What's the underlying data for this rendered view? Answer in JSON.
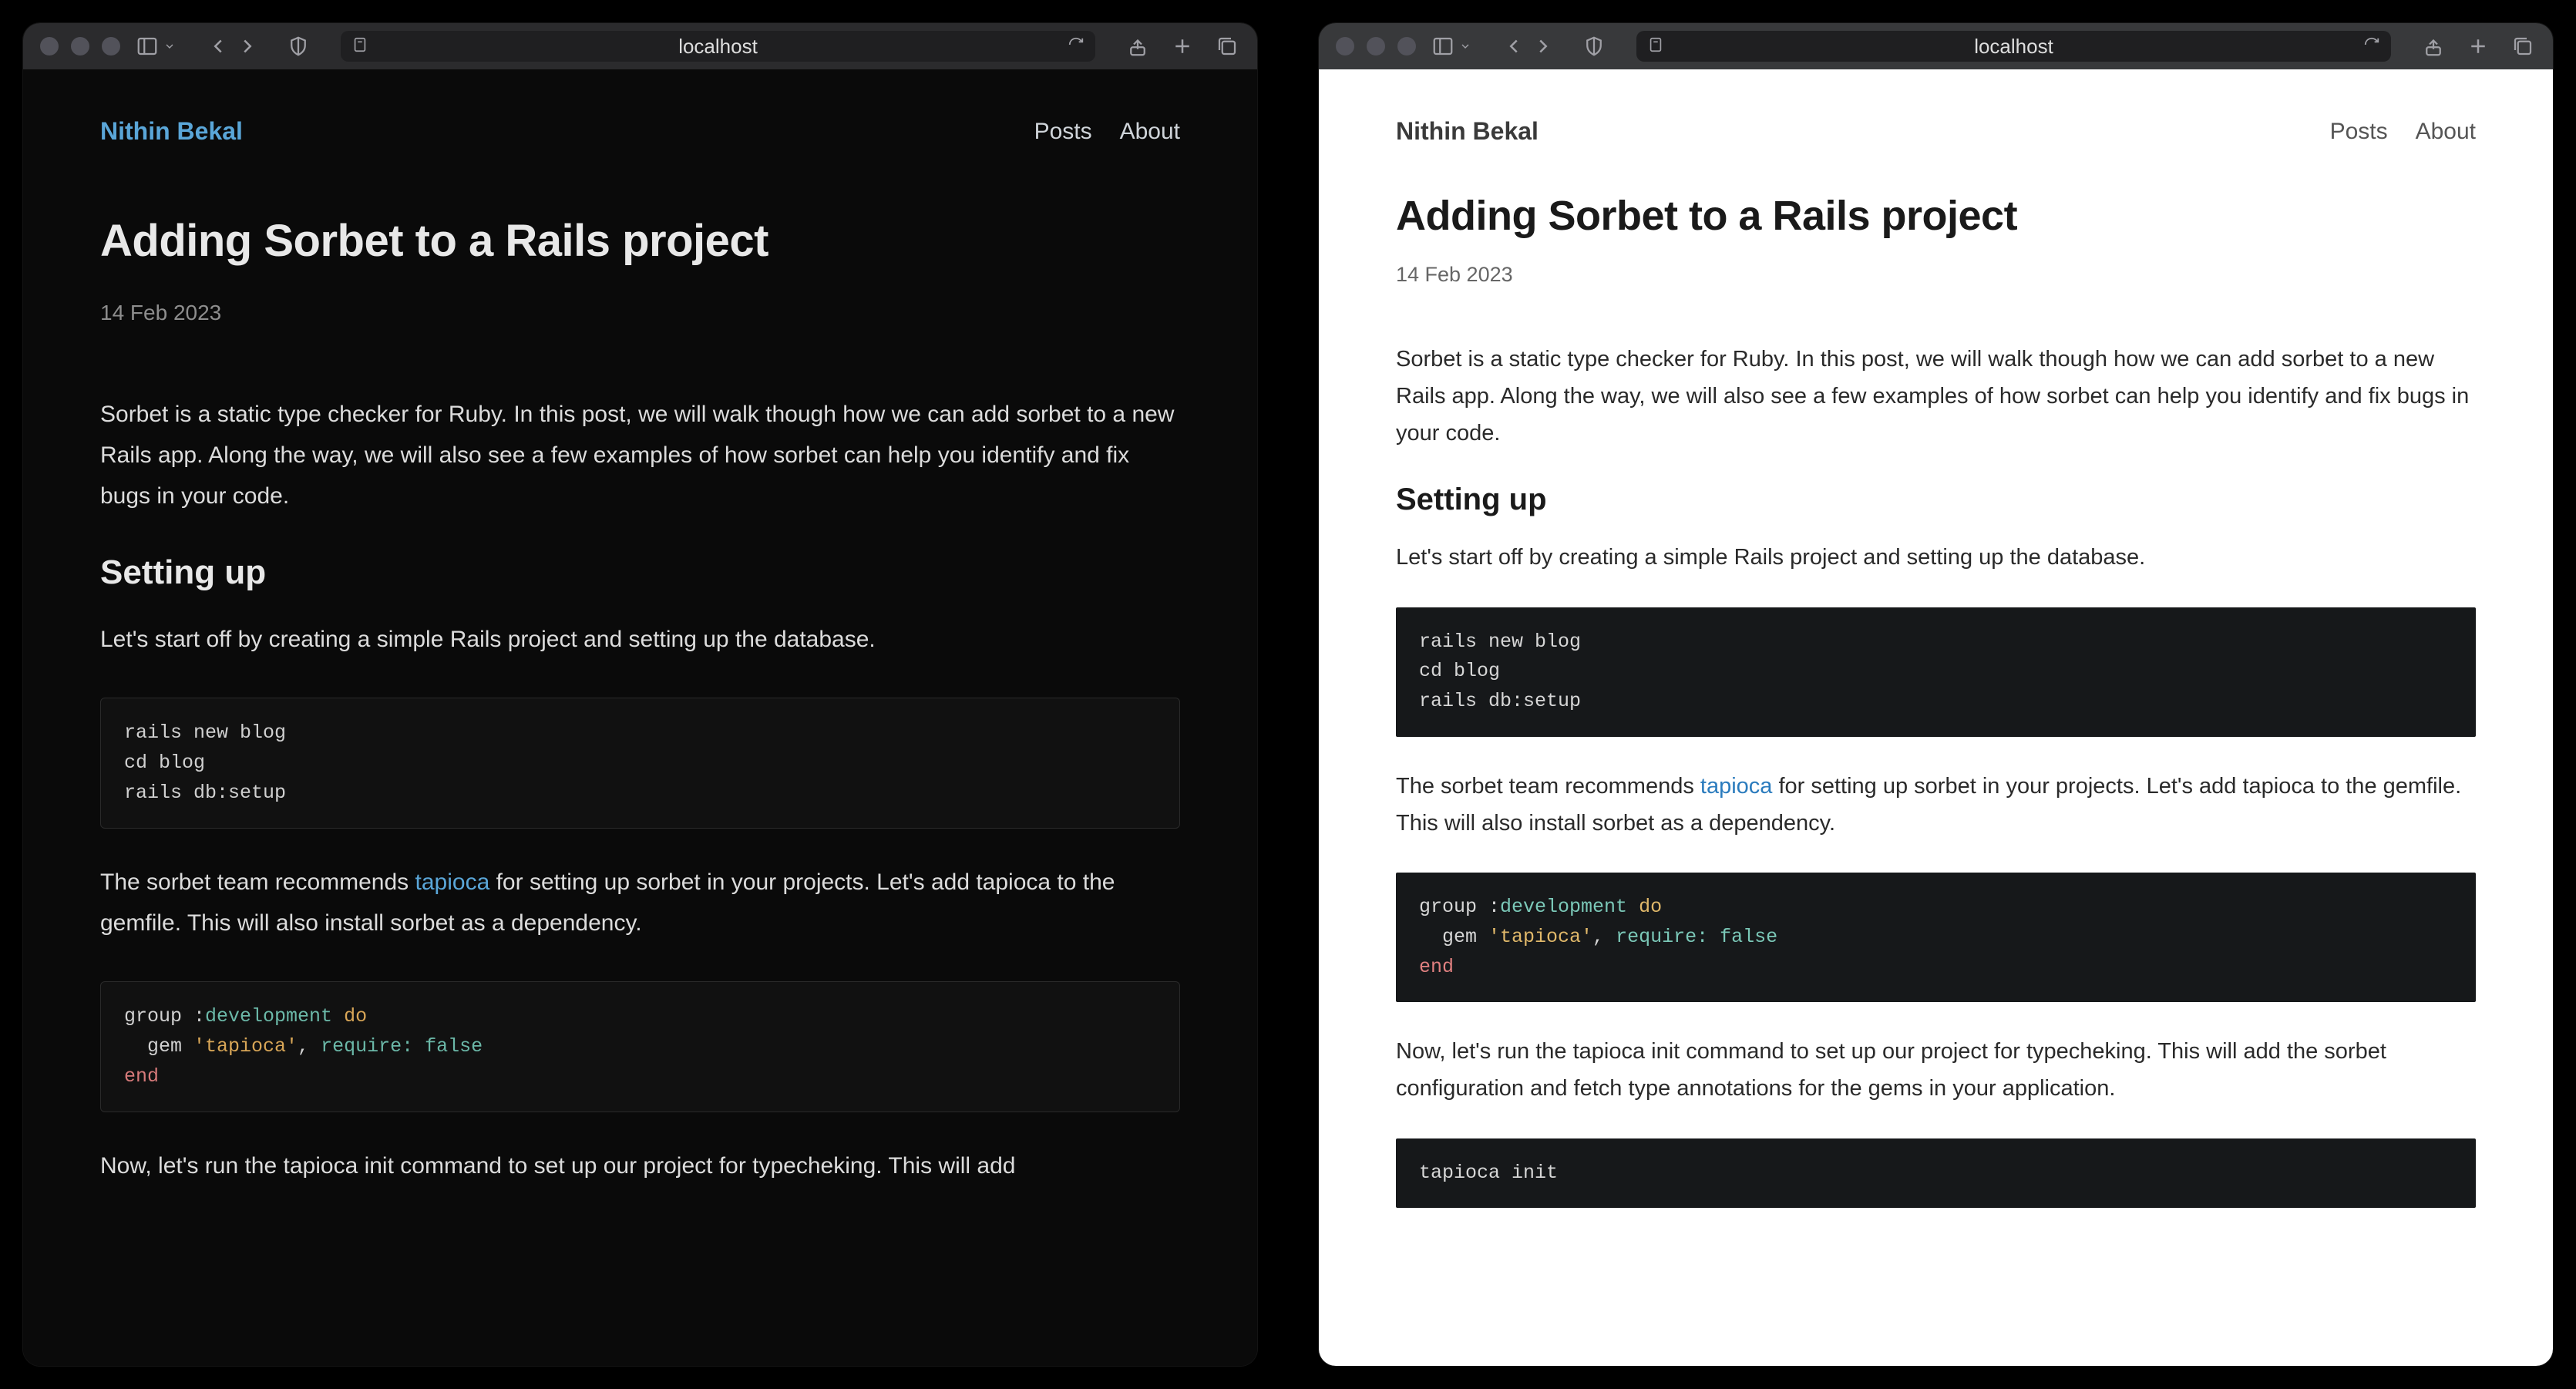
{
  "browser": {
    "url": "localhost"
  },
  "site": {
    "brand": "Nithin Bekal",
    "nav": {
      "posts": "Posts",
      "about": "About"
    }
  },
  "post": {
    "title": "Adding Sorbet to a Rails project",
    "date": "14 Feb 2023",
    "intro": "Sorbet is a static type checker for Ruby. In this post, we will walk though how we can add sorbet to a new Rails app. Along the way, we will also see a few examples of how sorbet can help you identify and fix bugs in your code.",
    "h2_setup": "Setting up",
    "setup_text": "Let's start off by creating a simple Rails project and setting up the database.",
    "code1": "rails new blog\ncd blog\nrails db:setup",
    "tapioca_pre": "The sorbet team recommends ",
    "tapioca_link": "tapioca",
    "tapioca_post": " for setting up sorbet in your projects. Let's add tapioca to the gemfile. This will also install sorbet as a dependency.",
    "code2": {
      "l1_a": "group :",
      "l1_b": "development",
      "l1_c": " do",
      "l2_a": "  gem ",
      "l2_b": "'tapioca'",
      "l2_c": ", ",
      "l2_d": "require:",
      "l2_e": " ",
      "l2_f": "false",
      "l3": "end"
    },
    "init_text_dark": "Now, let's run the tapioca init command to set up our project for typecheking. This will add",
    "init_text_light": "Now, let's run the tapioca init command to set up our project for typecheking. This will add the sorbet configuration and fetch type annotations for the gems in your application.",
    "code3": "tapioca init"
  }
}
